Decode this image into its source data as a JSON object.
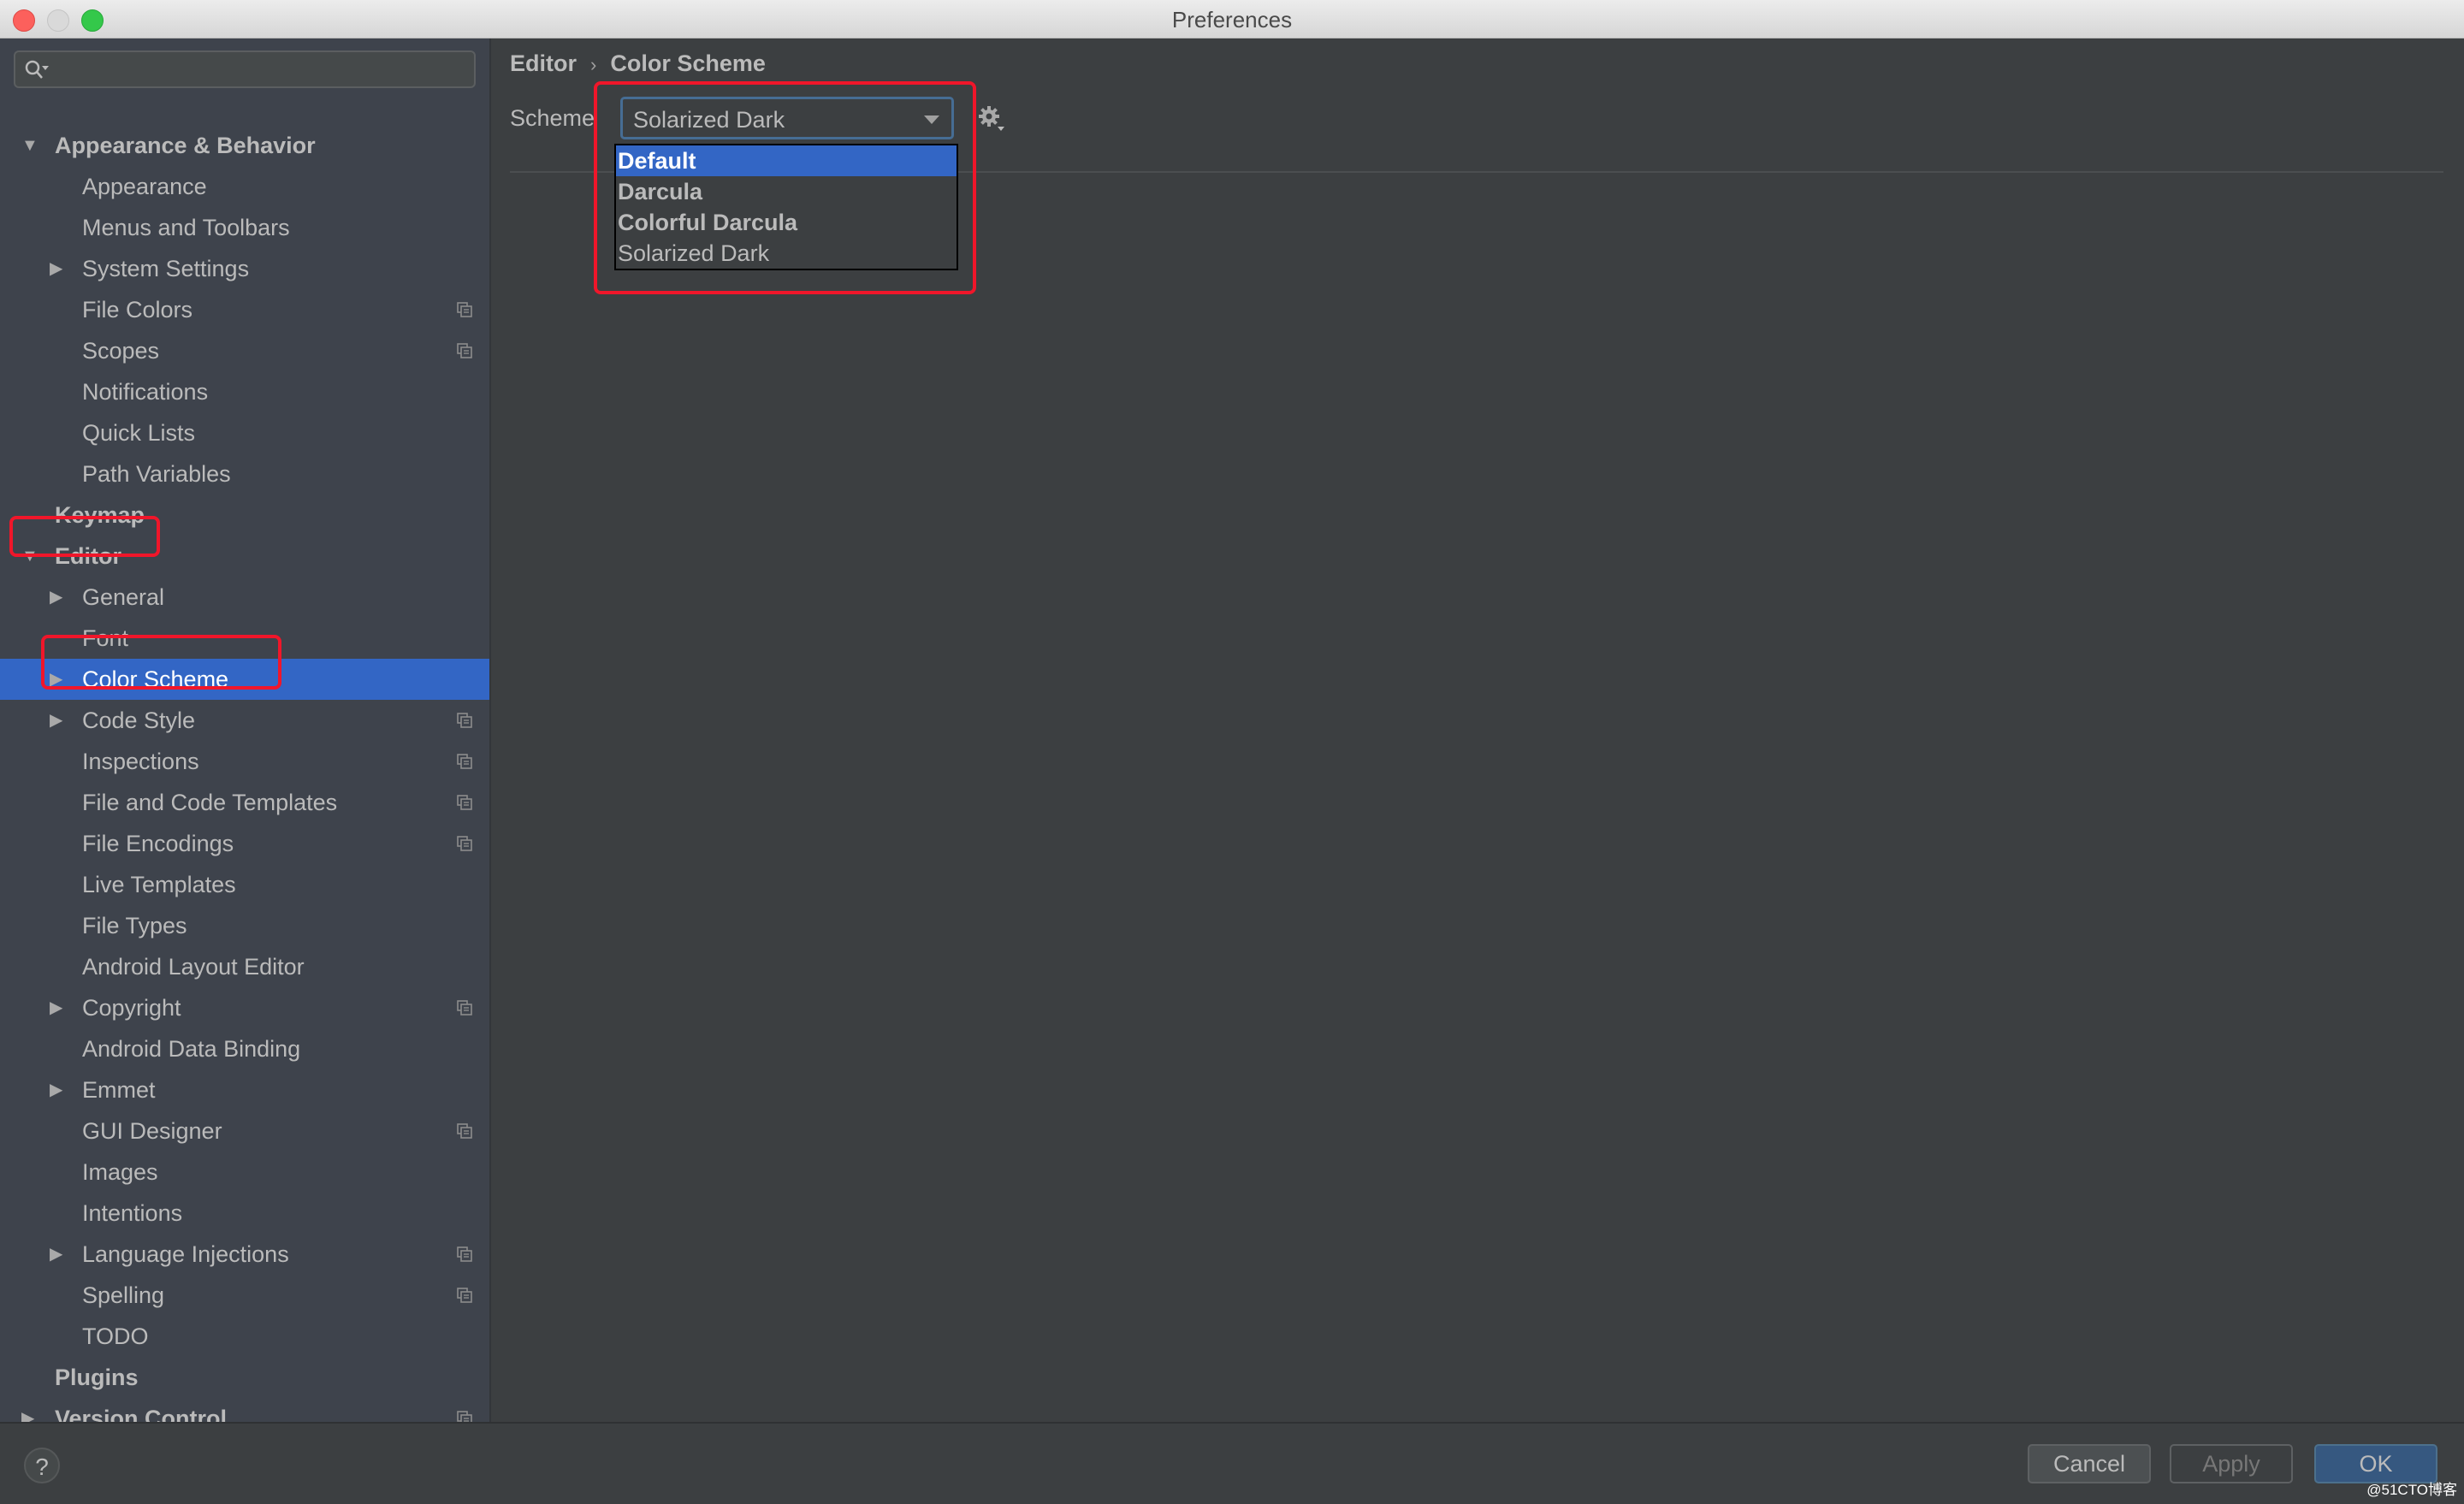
{
  "window": {
    "title": "Preferences",
    "controls": [
      "close",
      "minimize",
      "maximize"
    ]
  },
  "sidebar": {
    "search": {
      "value": "",
      "placeholder": ""
    },
    "items": [
      {
        "label": "Appearance & Behavior",
        "level": 0,
        "arrow": "▼",
        "shared": false
      },
      {
        "label": "Appearance",
        "level": 1,
        "arrow": "",
        "shared": false
      },
      {
        "label": "Menus and Toolbars",
        "level": 1,
        "arrow": "",
        "shared": false
      },
      {
        "label": "System Settings",
        "level": 1,
        "arrow": "▶",
        "shared": false
      },
      {
        "label": "File Colors",
        "level": 1,
        "arrow": "",
        "shared": true
      },
      {
        "label": "Scopes",
        "level": 1,
        "arrow": "",
        "shared": true
      },
      {
        "label": "Notifications",
        "level": 1,
        "arrow": "",
        "shared": false
      },
      {
        "label": "Quick Lists",
        "level": 1,
        "arrow": "",
        "shared": false
      },
      {
        "label": "Path Variables",
        "level": 1,
        "arrow": "",
        "shared": false
      },
      {
        "label": "Keymap",
        "level": 0,
        "arrow": "",
        "shared": false
      },
      {
        "label": "Editor",
        "level": 0,
        "arrow": "▼",
        "shared": false
      },
      {
        "label": "General",
        "level": 1,
        "arrow": "▶",
        "shared": false
      },
      {
        "label": "Font",
        "level": 1,
        "arrow": "",
        "shared": false
      },
      {
        "label": "Color Scheme",
        "level": 1,
        "arrow": "▶",
        "shared": false,
        "selected": true
      },
      {
        "label": "Code Style",
        "level": 1,
        "arrow": "▶",
        "shared": true
      },
      {
        "label": "Inspections",
        "level": 1,
        "arrow": "",
        "shared": true
      },
      {
        "label": "File and Code Templates",
        "level": 1,
        "arrow": "",
        "shared": true
      },
      {
        "label": "File Encodings",
        "level": 1,
        "arrow": "",
        "shared": true
      },
      {
        "label": "Live Templates",
        "level": 1,
        "arrow": "",
        "shared": false
      },
      {
        "label": "File Types",
        "level": 1,
        "arrow": "",
        "shared": false
      },
      {
        "label": "Android Layout Editor",
        "level": 1,
        "arrow": "",
        "shared": false
      },
      {
        "label": "Copyright",
        "level": 1,
        "arrow": "▶",
        "shared": true
      },
      {
        "label": "Android Data Binding",
        "level": 1,
        "arrow": "",
        "shared": false
      },
      {
        "label": "Emmet",
        "level": 1,
        "arrow": "▶",
        "shared": false
      },
      {
        "label": "GUI Designer",
        "level": 1,
        "arrow": "",
        "shared": true
      },
      {
        "label": "Images",
        "level": 1,
        "arrow": "",
        "shared": false
      },
      {
        "label": "Intentions",
        "level": 1,
        "arrow": "",
        "shared": false
      },
      {
        "label": "Language Injections",
        "level": 1,
        "arrow": "▶",
        "shared": true
      },
      {
        "label": "Spelling",
        "level": 1,
        "arrow": "",
        "shared": true
      },
      {
        "label": "TODO",
        "level": 1,
        "arrow": "",
        "shared": false
      },
      {
        "label": "Plugins",
        "level": 0,
        "arrow": "",
        "shared": false
      },
      {
        "label": "Version Control",
        "level": 0,
        "arrow": "▶",
        "shared": true
      }
    ]
  },
  "content": {
    "breadcrumb": [
      "Editor",
      "Color Scheme"
    ],
    "breadcrumb_separator": "›",
    "scheme_label": "Scheme",
    "scheme_value": "Solarized Dark",
    "scheme_options": [
      {
        "label": "Default",
        "bold": true,
        "highlighted": true
      },
      {
        "label": "Darcula",
        "bold": true,
        "highlighted": false
      },
      {
        "label": "Colorful Darcula",
        "bold": true,
        "highlighted": false
      },
      {
        "label": "Solarized Dark",
        "bold": false,
        "highlighted": false
      }
    ],
    "gear_icon": "gear-icon"
  },
  "footer": {
    "help_label": "?",
    "cancel_label": "Cancel",
    "apply_label": "Apply",
    "ok_label": "OK",
    "watermark": "@51CTO博客"
  },
  "colors": {
    "selection": "#3366c5",
    "annotation": "#f0162a",
    "ok_button": "#365880"
  }
}
